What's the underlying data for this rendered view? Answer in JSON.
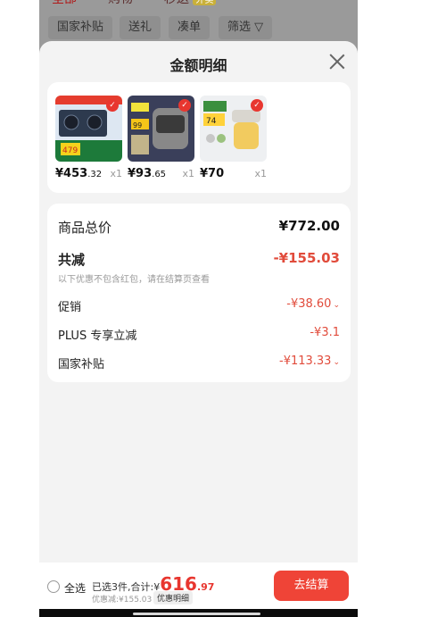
{
  "top_tabs": [
    {
      "label": "全部",
      "active": true
    },
    {
      "label": "购物",
      "active": false
    },
    {
      "label": "秒送",
      "active": false,
      "badge": "外卖"
    }
  ],
  "filters": [
    "国家补贴",
    "送礼",
    "凑单",
    "筛选 ▽"
  ],
  "sheet": {
    "title": "金额明细",
    "products": [
      {
        "price": "¥453",
        "price_decimal": ".32",
        "qty": "x1",
        "icon": "gas-stove-thumbnail"
      },
      {
        "price": "¥93",
        "price_decimal": ".65",
        "qty": "x1",
        "icon": "rice-cooker-thumbnail"
      },
      {
        "price": "¥70",
        "price_decimal": "",
        "qty": "x1",
        "icon": "blender-thumbnail"
      }
    ],
    "detail": {
      "total_label": "商品总价",
      "total_value": "¥772.00",
      "minus_label": "共减",
      "minus_value": "-¥155.03",
      "note": "以下优惠不包含红包，请在结算页查看",
      "promo_label": "促销",
      "promo_value": "-¥38.60",
      "plus_label": "PLUS 专享立减",
      "plus_value": "-¥3.1",
      "subsidy_label": "国家补贴",
      "subsidy_value": "-¥113.33"
    }
  },
  "bottom": {
    "select_all": "全选",
    "summary_prefix": "已选3件,合计:¥",
    "amount_int": "616",
    "amount_dec": ".97",
    "discount": "优惠减:¥155.03",
    "detail_pill": "优惠明细",
    "checkout": "去结算"
  },
  "colors": {
    "accent": "#ef4437",
    "price_red": "#e14b3b"
  }
}
